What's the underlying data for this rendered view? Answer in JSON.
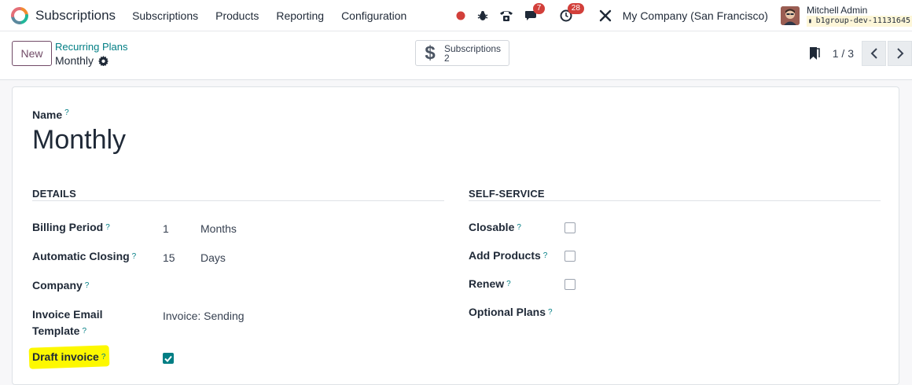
{
  "navbar": {
    "app_name": "Subscriptions",
    "menu": [
      "Subscriptions",
      "Products",
      "Reporting",
      "Configuration"
    ],
    "chat_count": "7",
    "activity_count": "28",
    "company": "My Company (San Francisco)",
    "user_name": "Mitchell Admin",
    "database": "b1group-dev-11131645"
  },
  "control_panel": {
    "new_label": "New",
    "breadcrumb": "Recurring Plans",
    "record_title": "Monthly",
    "smart_button": {
      "label": "Subscriptions",
      "count": "2",
      "icon": "dollar-icon"
    },
    "pager": "1 / 3"
  },
  "form": {
    "name_label": "Name",
    "help_mark": "?",
    "name_value": "Monthly",
    "details": {
      "title": "DETAILS",
      "billing_period_label": "Billing Period",
      "billing_period_value": "1",
      "billing_period_unit": "Months",
      "auto_closing_label": "Automatic Closing",
      "auto_closing_value": "15",
      "auto_closing_unit": "Days",
      "company_label": "Company",
      "email_template_label_1": "Invoice Email",
      "email_template_label_2": "Template",
      "email_template_value": "Invoice: Sending",
      "draft_invoice_label": "Draft invoice",
      "draft_invoice_checked": true
    },
    "self_service": {
      "title": "SELF-SERVICE",
      "closable_label": "Closable",
      "closable_checked": false,
      "add_products_label": "Add Products",
      "add_products_checked": false,
      "renew_label": "Renew",
      "renew_checked": false,
      "optional_plans_label": "Optional Plans"
    }
  },
  "colors": {
    "brand": "#714b67",
    "accent": "#017e84",
    "badge": "#d23f3a",
    "highlight": "#fdf800"
  }
}
